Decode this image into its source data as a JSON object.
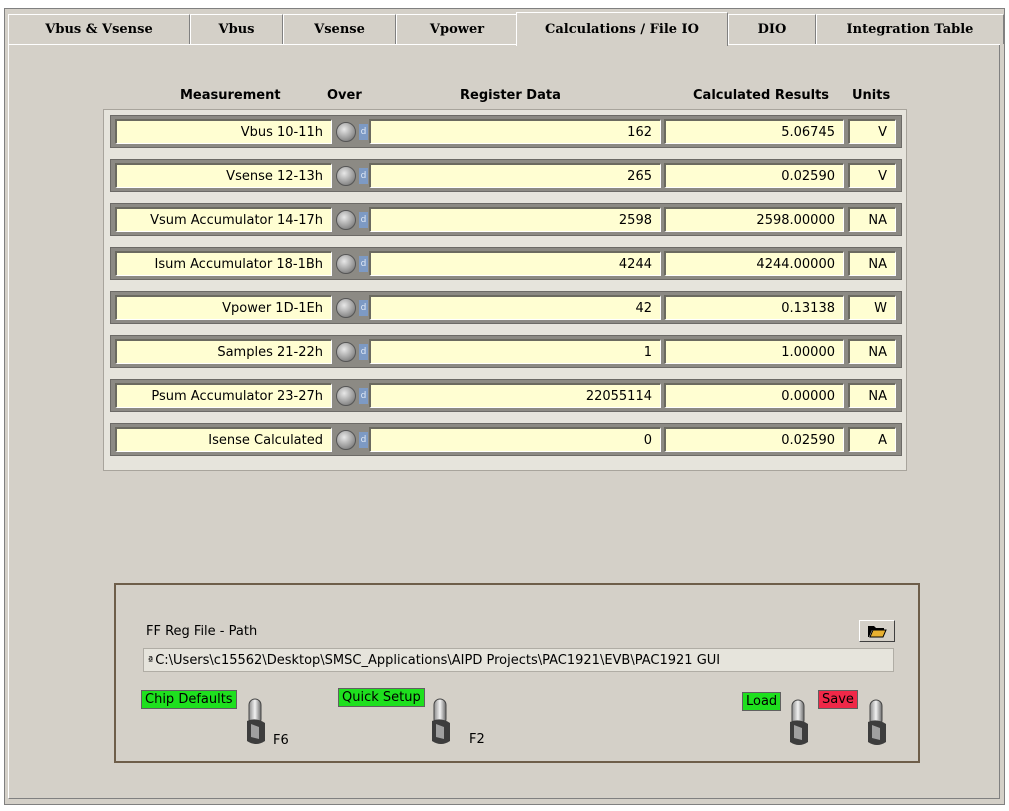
{
  "tabs": [
    {
      "label": "Vbus & Vsense",
      "active": false
    },
    {
      "label": "Vbus",
      "active": false
    },
    {
      "label": "Vsense",
      "active": false
    },
    {
      "label": "Vpower",
      "active": false
    },
    {
      "label": "Calculations / File IO",
      "active": true
    },
    {
      "label": "DIO",
      "active": false
    },
    {
      "label": "Integration Table",
      "active": false
    }
  ],
  "headers": {
    "measurement": "Measurement",
    "over": "Over",
    "register_data": "Register Data",
    "calculated_results": "Calculated Results",
    "units": "Units"
  },
  "rows": [
    {
      "name": "Vbus 10-11h",
      "d": "d",
      "register": "162",
      "result": "5.06745",
      "unit": "V"
    },
    {
      "name": "Vsense 12-13h",
      "d": "d",
      "register": "265",
      "result": "0.02590",
      "unit": "V"
    },
    {
      "name": "Vsum  Accumulator 14-17h",
      "d": "d",
      "register": "2598",
      "result": "2598.00000",
      "unit": "NA"
    },
    {
      "name": "Isum Accumulator 18-1Bh",
      "d": "d",
      "register": "4244",
      "result": "4244.00000",
      "unit": "NA"
    },
    {
      "name": "Vpower 1D-1Eh",
      "d": "d",
      "register": "42",
      "result": "0.13138",
      "unit": "W"
    },
    {
      "name": "Samples 21-22h",
      "d": "d",
      "register": "1",
      "result": "1.00000",
      "unit": "NA"
    },
    {
      "name": "Psum Accumulator 23-27h",
      "d": "d",
      "register": "22055114",
      "result": "0.00000",
      "unit": "NA"
    },
    {
      "name": "Isense Calculated",
      "d": "d",
      "register": "0",
      "result": "0.02590",
      "unit": "A"
    }
  ],
  "file": {
    "label": "FF Reg File - Path",
    "path": "C:\\Users\\c15562\\Desktop\\SMSC_Applications\\AIPD Projects\\PAC1921\\EVB\\PAC1921 GUI",
    "path_badge": "ª"
  },
  "controls": {
    "chip_defaults": "Chip Defaults",
    "chip_defaults_key": "F6",
    "quick_setup": "Quick Setup",
    "quick_setup_key": "F2",
    "load": "Load",
    "save": "Save"
  },
  "colors": {
    "panel_bg": "#d4d0c8",
    "indicator_bg": "#fffed2",
    "green_label": "#1ee01e",
    "red_label": "#f02848"
  }
}
